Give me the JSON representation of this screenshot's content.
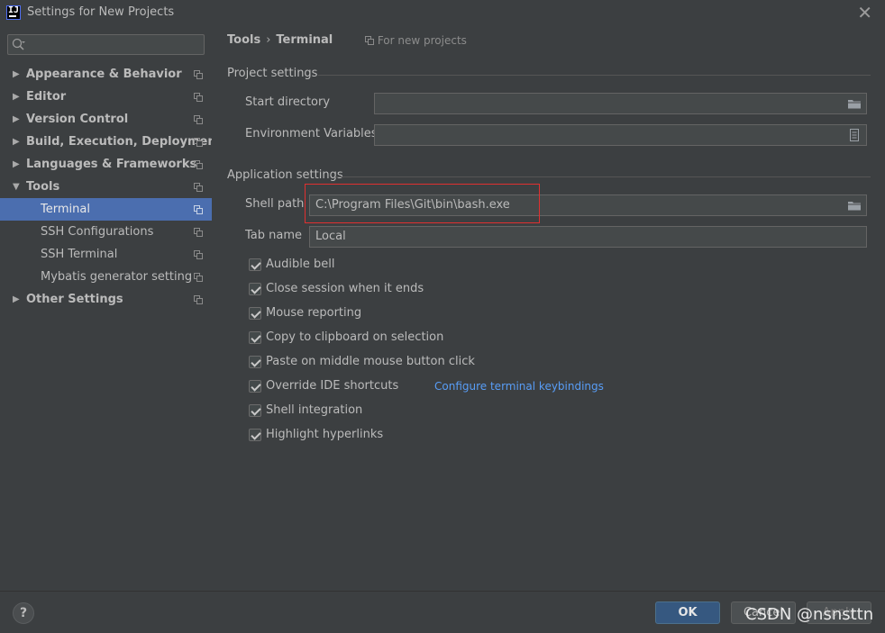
{
  "window": {
    "title": "Settings for New Projects"
  },
  "sidebar": {
    "search": {
      "placeholder": ""
    },
    "items": [
      {
        "label": "Appearance & Behavior",
        "expanded": false,
        "level": 0
      },
      {
        "label": "Editor",
        "expanded": false,
        "level": 0
      },
      {
        "label": "Version Control",
        "expanded": false,
        "level": 0
      },
      {
        "label": "Build, Execution, Deployment",
        "expanded": false,
        "level": 0
      },
      {
        "label": "Languages & Frameworks",
        "expanded": false,
        "level": 0
      },
      {
        "label": "Tools",
        "expanded": true,
        "level": 0
      },
      {
        "label": "Terminal",
        "level": 1,
        "selected": true
      },
      {
        "label": "SSH Configurations",
        "level": 1
      },
      {
        "label": "SSH Terminal",
        "level": 1
      },
      {
        "label": "Mybatis generator setting",
        "level": 1
      },
      {
        "label": "Other Settings",
        "expanded": false,
        "level": 0
      }
    ]
  },
  "header": {
    "breadcrumb": [
      "Tools",
      "Terminal"
    ],
    "scope": "For new projects"
  },
  "project_settings": {
    "title": "Project settings",
    "start_directory": {
      "label": "Start directory",
      "value": ""
    },
    "env_vars": {
      "label": "Environment Variables",
      "value": ""
    }
  },
  "application_settings": {
    "title": "Application settings",
    "shell_path": {
      "label": "Shell path",
      "value": "C:\\Program Files\\Git\\bin\\bash.exe"
    },
    "tab_name": {
      "label": "Tab name",
      "value": "Local"
    },
    "checkboxes": [
      {
        "label": "Audible bell",
        "checked": true
      },
      {
        "label": "Close session when it ends",
        "checked": true
      },
      {
        "label": "Mouse reporting",
        "checked": true
      },
      {
        "label": "Copy to clipboard on selection",
        "checked": true
      },
      {
        "label": "Paste on middle mouse button click",
        "checked": true
      },
      {
        "label": "Override IDE shortcuts",
        "checked": true,
        "link": "Configure terminal keybindings"
      },
      {
        "label": "Shell integration",
        "checked": true
      },
      {
        "label": "Highlight hyperlinks",
        "checked": true
      }
    ]
  },
  "footer": {
    "help": "?",
    "ok": "OK",
    "cancel": "Cancel",
    "apply": "Apply",
    "watermark": "CSDN @nsnsttn"
  },
  "colors": {
    "background": "#3c3f41",
    "selection": "#4b6eaf",
    "link": "#589df6",
    "ok_button": "#365880",
    "highlight_box": "#e03030"
  }
}
